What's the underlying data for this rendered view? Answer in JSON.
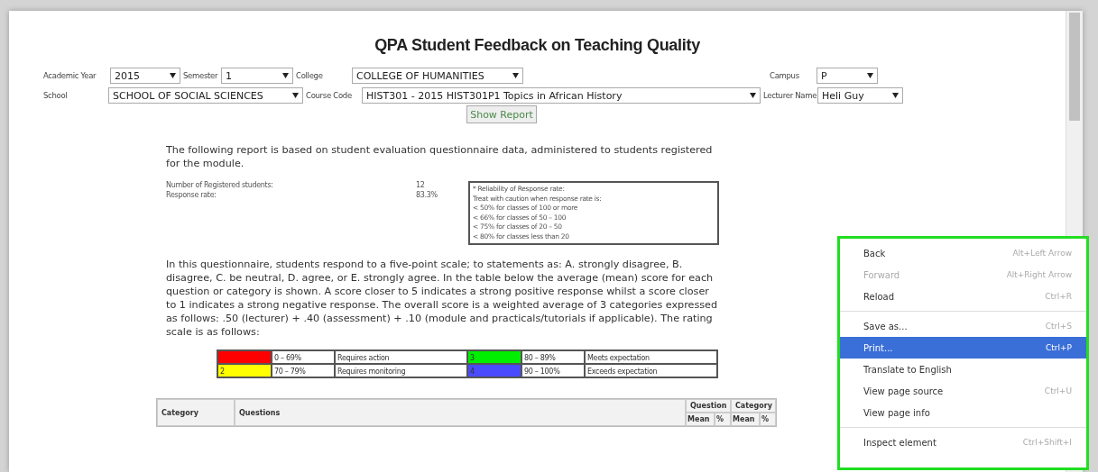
{
  "title": "QPA Student Feedback on Teaching Quality",
  "filters": [
    {
      "label": "Academic Year",
      "value": "2015"
    },
    {
      "label": "Semester",
      "value": "1"
    },
    {
      "label": "College",
      "value": "COLLEGE OF HUMANITIES"
    },
    {
      "label": "Campus",
      "value": "P"
    },
    {
      "label": "School",
      "value": "SCHOOL OF SOCIAL SCIENCES"
    },
    {
      "label": "Course Code",
      "value": "HIST301 - 2015 HIST301P1 Topics in African History"
    },
    {
      "label": "Lecturer Name",
      "value": "Heli Guy"
    }
  ],
  "show_button": "Show Report",
  "intro": "The following report is based on student evaluation questionnaire data, administered to students registered for the module.",
  "stats": [
    {
      "label": "Number of Registered students:",
      "value": "12"
    },
    {
      "label": "Response rate:",
      "value": "83.3%"
    }
  ],
  "reliability_note": [
    "* Reliability of Response rate:",
    "Treat with caution when response rate is:",
    "< 50% for classes of 100 or more",
    "< 66% for classes of 50 – 100",
    "< 75% for classes of 20 – 50",
    "< 80% for classes less than 20"
  ],
  "explanation": "In this questionnaire, students respond to a five-point scale; to statements as: A. strongly disagree, B. disagree, C. be neutral, D. agree, or E. strongly agree. In the table below the average (mean) score for each question or category is shown. A score closer to 5 indicates a strong positive response whilst a score closer to 1 indicates a strong negative response. The overall score is a weighted average of 3 categories expressed as follows: .50 (lecturer) + .40 (assessment) + .10 (module and practicals/tutorials if applicable). The rating scale is as follows:",
  "legend": [
    {
      "color": "#ff0000",
      "range": "0 – 69%",
      "meaning": "Requires action"
    },
    {
      "level": "3",
      "color": "#00ee00",
      "range": "80 – 89%",
      "meaning": "Meets expectation"
    },
    {
      "level": "2",
      "color": "#ffff00",
      "range": "70 – 79%",
      "meaning": "Requires monitoring"
    },
    {
      "level": "4",
      "color": "#4a4aff",
      "range": "90 – 100%",
      "meaning": "Exceeds expectation"
    }
  ],
  "table": {
    "columns": [
      "Category",
      "Questions"
    ],
    "groups": [
      {
        "label": "Question",
        "sub": [
          "Mean",
          "%"
        ]
      },
      {
        "label": "Category",
        "sub": [
          "Mean",
          "%"
        ]
      }
    ]
  },
  "context_menu": [
    [
      {
        "label": "Back",
        "shortcut": "Alt+Left Arrow",
        "disabled": false,
        "selected": false
      },
      {
        "label": "Forward",
        "shortcut": "Alt+Right Arrow",
        "disabled": true,
        "selected": false
      },
      {
        "label": "Reload",
        "shortcut": "Ctrl+R",
        "disabled": false,
        "selected": false
      }
    ],
    [
      {
        "label": "Save as...",
        "shortcut": "Ctrl+S",
        "disabled": false,
        "selected": false
      },
      {
        "label": "Print...",
        "shortcut": "Ctrl+P",
        "disabled": false,
        "selected": true
      },
      {
        "label": "Translate to English",
        "disabled": false,
        "selected": false
      },
      {
        "label": "View page source",
        "shortcut": "Ctrl+U",
        "disabled": false,
        "selected": false
      },
      {
        "label": "View page info",
        "disabled": false,
        "selected": false
      }
    ],
    [
      {
        "label": "Inspect element",
        "shortcut": "Ctrl+Shift+I",
        "disabled": false,
        "selected": false
      }
    ]
  ]
}
